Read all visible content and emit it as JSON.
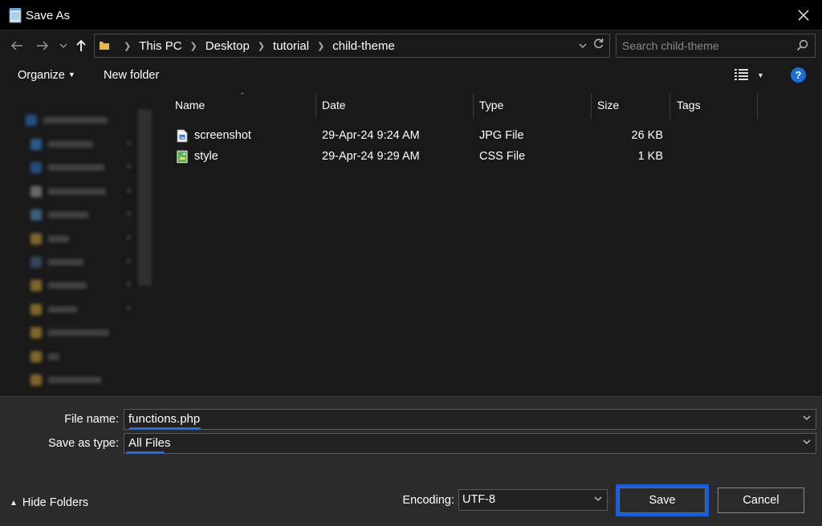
{
  "window": {
    "title": "Save As"
  },
  "address": {
    "crumbs": [
      "This PC",
      "Desktop",
      "tutorial",
      "child-theme"
    ]
  },
  "search": {
    "placeholder": "Search child-theme"
  },
  "toolbar": {
    "organize_label": "Organize",
    "new_folder_label": "New folder"
  },
  "columns": {
    "name": "Name",
    "date": "Date",
    "type": "Type",
    "size": "Size",
    "tags": "Tags"
  },
  "files": [
    {
      "name": "screenshot",
      "date": "29-Apr-24 9:24 AM",
      "type": "JPG File",
      "size": "26 KB",
      "icon": "image-file-icon"
    },
    {
      "name": "style",
      "date": "29-Apr-24 9:29 AM",
      "type": "CSS File",
      "size": "1 KB",
      "icon": "css-file-icon"
    }
  ],
  "form": {
    "file_name_label": "File name:",
    "file_name_value": "functions.php",
    "save_type_label": "Save as type:",
    "save_type_value": "All Files",
    "encoding_label": "Encoding:",
    "encoding_value": "UTF-8"
  },
  "footer": {
    "hide_folders_label": "Hide Folders",
    "save_label": "Save",
    "cancel_label": "Cancel"
  },
  "colors": {
    "highlight": "#1b6ef5",
    "help": "#1a6fd6"
  }
}
